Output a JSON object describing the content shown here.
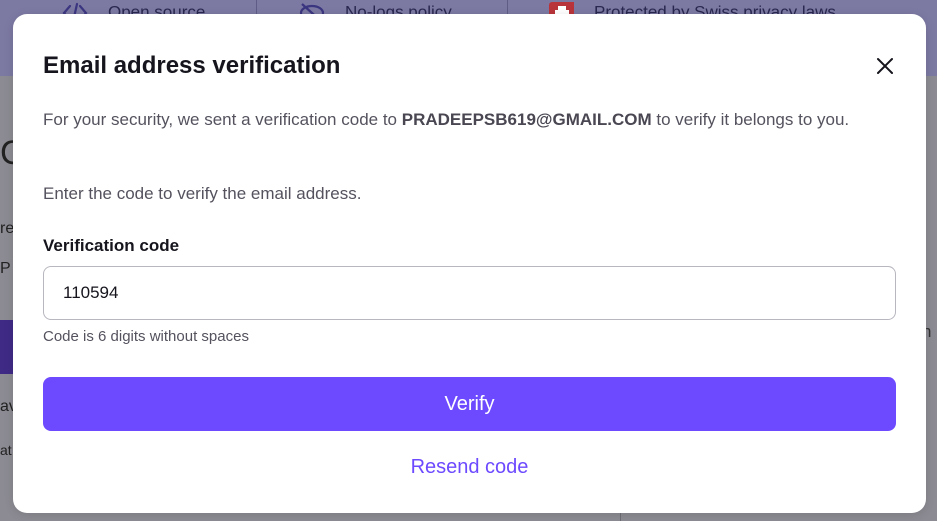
{
  "background": {
    "features": [
      {
        "label": "Open source",
        "icon": "code-icon"
      },
      {
        "label": "No-logs policy",
        "icon": "eye-slash-icon"
      },
      {
        "label": "Protected by Swiss privacy laws",
        "icon": "swiss-flag-icon"
      }
    ],
    "left_fragments": [
      "C",
      "re",
      "P",
      "av",
      "at"
    ],
    "right_fragment": "h"
  },
  "modal": {
    "title": "Email address verification",
    "description_prefix": "For your security, we sent a verification code to ",
    "email": "PRADEEPSB619@GMAIL.COM",
    "description_suffix": " to verify it belongs to you.",
    "instruction": "Enter the code to verify the email address.",
    "field_label": "Verification code",
    "code_value": "110594",
    "hint": "Code is 6 digits without spaces",
    "verify_label": "Verify",
    "resend_label": "Resend code",
    "close_icon": "close-icon"
  },
  "colors": {
    "accent": "#6d4aff",
    "title_text": "#16141c",
    "body_text": "#55525e",
    "overlay": "#8c8b93"
  }
}
